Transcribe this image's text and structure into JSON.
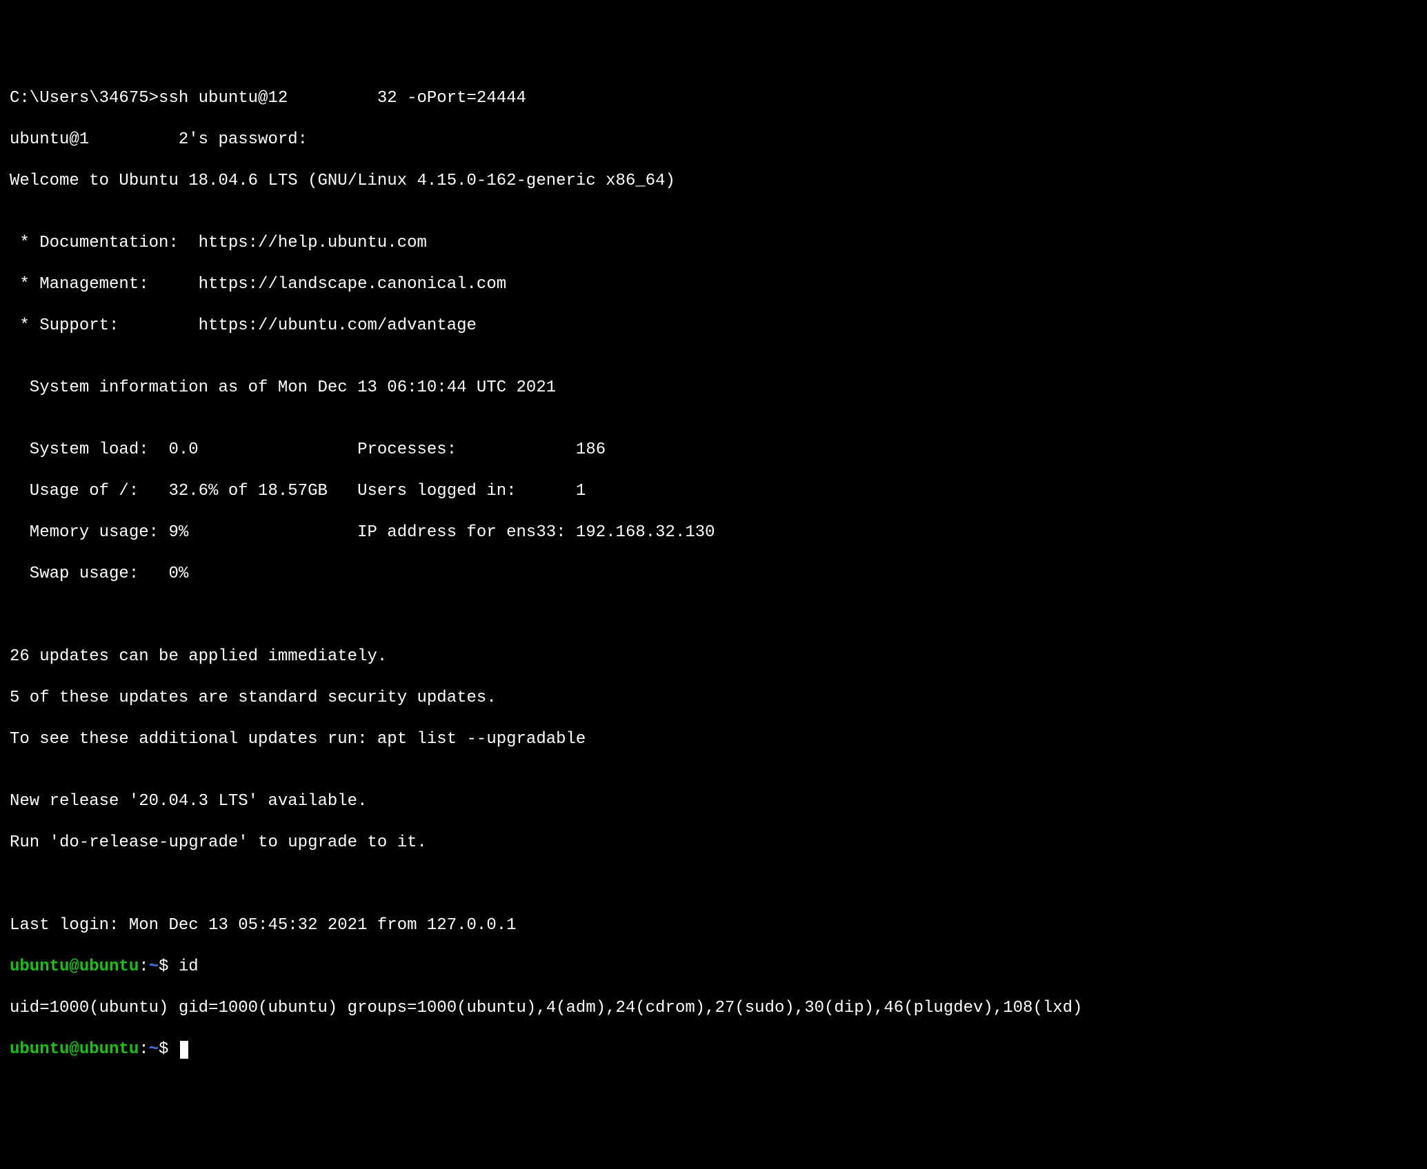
{
  "terminal": {
    "line_local_prompt": "C:\\Users\\34675>ssh ubuntu@12         32 -oPort=24444",
    "line_pw_prompt": "ubuntu@1         2's password:",
    "line_welcome": "Welcome to Ubuntu 18.04.6 LTS (GNU/Linux 4.15.0-162-generic x86_64)",
    "blank": "",
    "line_doc": " * Documentation:  https://help.ubuntu.com",
    "line_mgmt": " * Management:     https://landscape.canonical.com",
    "line_support": " * Support:        https://ubuntu.com/advantage",
    "line_sysinfo_header": "  System information as of Mon Dec 13 06:10:44 UTC 2021",
    "stat_load": "  System load:  0.0                Processes:            186",
    "stat_usage": "  Usage of /:   32.6% of 18.57GB   Users logged in:      1",
    "stat_mem": "  Memory usage: 9%                 IP address for ens33: 192.168.32.130",
    "stat_swap": "  Swap usage:   0%",
    "line_updates_count": "26 updates can be applied immediately.",
    "line_updates_sec": "5 of these updates are standard security updates.",
    "line_updates_hint": "To see these additional updates run: apt list --upgradable",
    "line_release": "New release '20.04.3 LTS' available.",
    "line_release_hint": "Run 'do-release-upgrade' to upgrade to it.",
    "line_last_login": "Last login: Mon Dec 13 05:45:32 2021 from 127.0.0.1",
    "prompt1": {
      "user": "ubuntu@ubuntu",
      "colon": ":",
      "path": "~",
      "dollar": "$ ",
      "cmd": "id"
    },
    "line_id_output": "uid=1000(ubuntu) gid=1000(ubuntu) groups=1000(ubuntu),4(adm),24(cdrom),27(sudo),30(dip),46(plugdev),108(lxd)",
    "prompt2": {
      "user": "ubuntu@ubuntu",
      "colon": ":",
      "path": "~",
      "dollar": "$ "
    }
  }
}
